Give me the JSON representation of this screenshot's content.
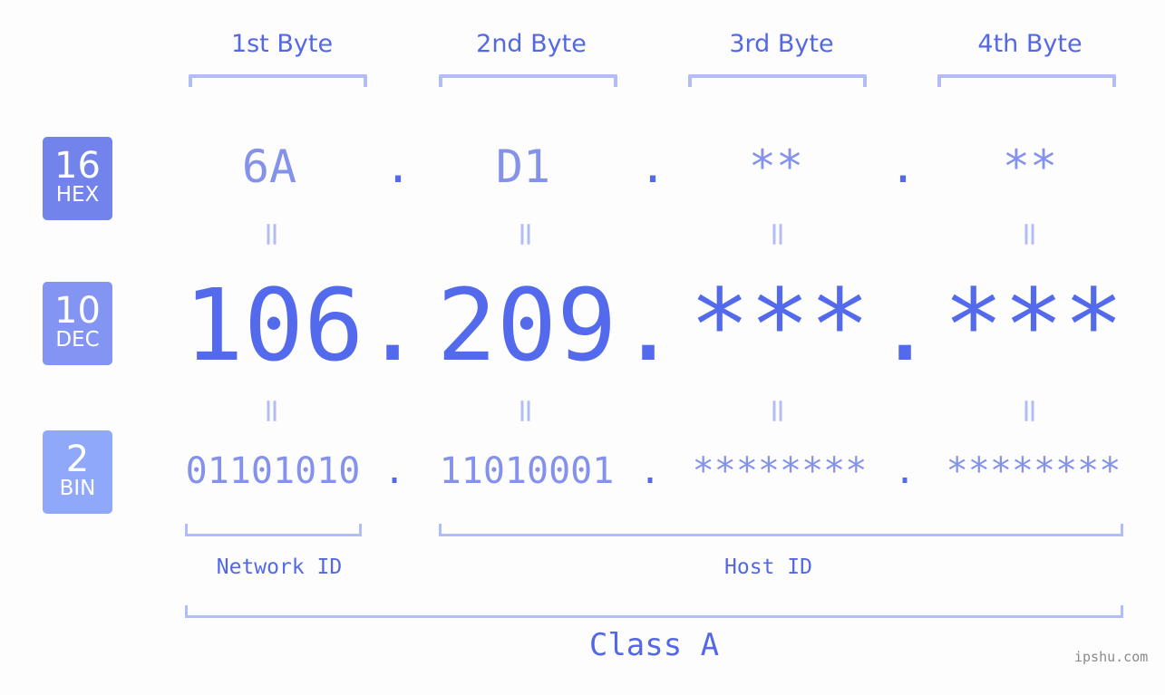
{
  "bytes": [
    {
      "label": "1st Byte",
      "hex": "6A",
      "dec": "106",
      "bin": "01101010"
    },
    {
      "label": "2nd Byte",
      "hex": "D1",
      "dec": "209",
      "bin": "11010001"
    },
    {
      "label": "3rd Byte",
      "hex": "**",
      "dec": "***",
      "bin": "********"
    },
    {
      "label": "4th Byte",
      "hex": "**",
      "dec": "***",
      "bin": "********"
    }
  ],
  "badges": {
    "hex": {
      "num": "16",
      "label": "HEX",
      "color": "#7383ec"
    },
    "dec": {
      "num": "10",
      "label": "DEC",
      "color": "#8494f2"
    },
    "bin": {
      "num": "2",
      "label": "BIN",
      "color": "#90a8fa"
    }
  },
  "separator": ".",
  "equals": "=",
  "network_id": "Network ID",
  "host_id": "Host ID",
  "class_label": "Class A",
  "watermark": "ipshu.com",
  "colors": {
    "accent": "#546aed",
    "light_value": "#8592ea",
    "bracket": "#b2bcf6"
  }
}
